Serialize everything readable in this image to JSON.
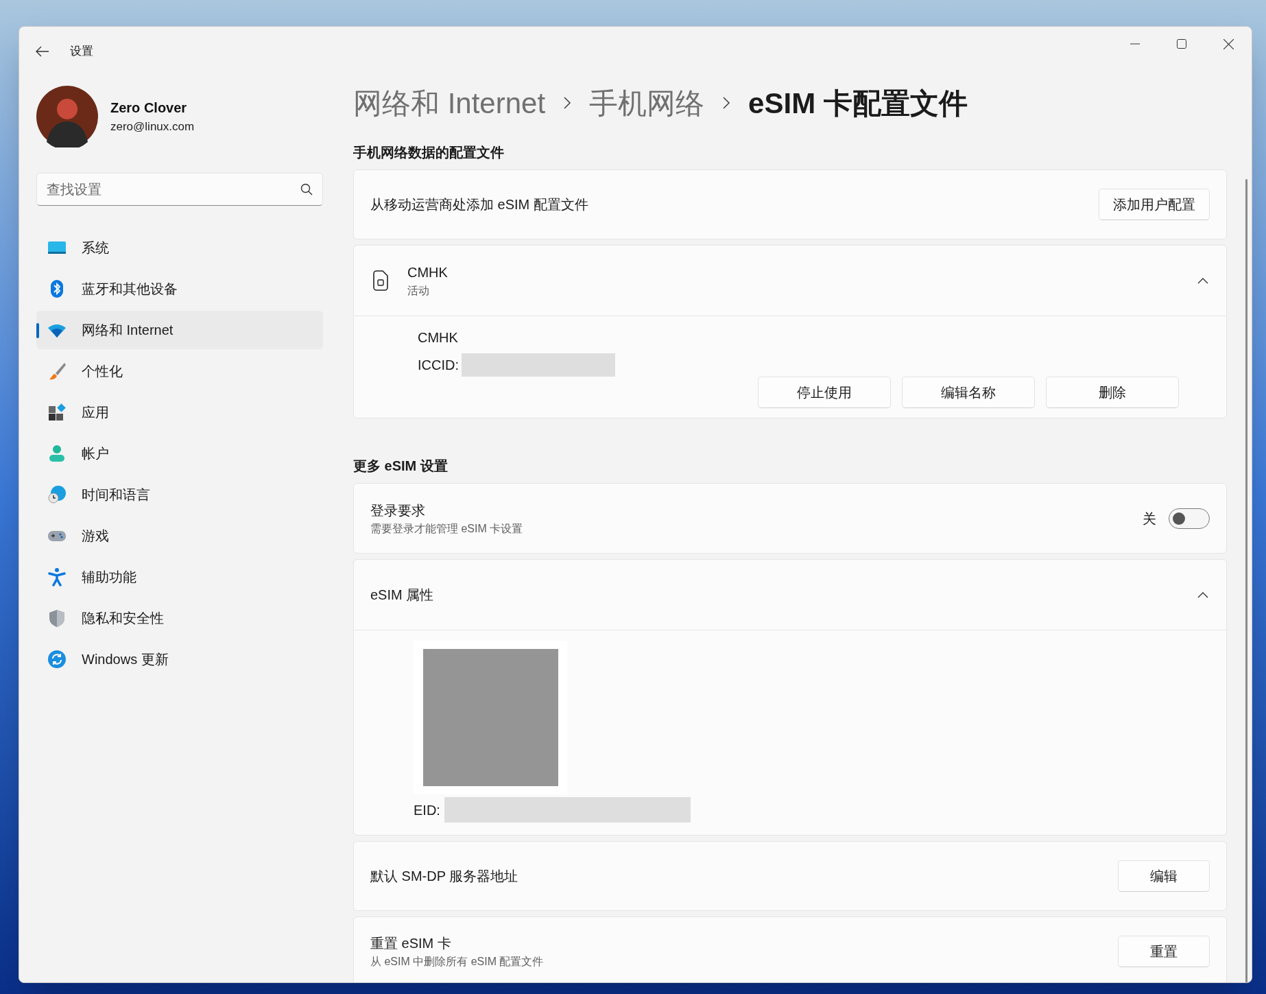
{
  "window": {
    "title": "设置"
  },
  "user": {
    "name": "Zero Clover",
    "email": "zero@linux.com"
  },
  "search": {
    "placeholder": "查找设置"
  },
  "nav": [
    {
      "kind": "system",
      "label": "系统",
      "selected": false
    },
    {
      "kind": "bluetooth",
      "label": "蓝牙和其他设备",
      "selected": false
    },
    {
      "kind": "network",
      "label": "网络和 Internet",
      "selected": true
    },
    {
      "kind": "personalization",
      "label": "个性化",
      "selected": false
    },
    {
      "kind": "apps",
      "label": "应用",
      "selected": false
    },
    {
      "kind": "accounts",
      "label": "帐户",
      "selected": false
    },
    {
      "kind": "time",
      "label": "时间和语言",
      "selected": false
    },
    {
      "kind": "gaming",
      "label": "游戏",
      "selected": false
    },
    {
      "kind": "accessibility",
      "label": "辅助功能",
      "selected": false
    },
    {
      "kind": "privacy",
      "label": "隐私和安全性",
      "selected": false
    },
    {
      "kind": "update",
      "label": "Windows 更新",
      "selected": false
    }
  ],
  "breadcrumb": [
    {
      "label": "网络和 Internet",
      "current": false
    },
    {
      "label": "手机网络",
      "current": false
    },
    {
      "label": "eSIM 卡配置文件",
      "current": true
    }
  ],
  "profiles_section": {
    "heading": "手机网络数据的配置文件",
    "add_row": {
      "label": "从移动运营商处添加 eSIM 配置文件",
      "button": "添加用户配置"
    },
    "profile": {
      "name": "CMHK",
      "status": "活动",
      "expanded": true,
      "detail_name": "CMHK",
      "iccid_label": "ICCID:",
      "buttons": [
        "停止使用",
        "编辑名称",
        "删除"
      ]
    }
  },
  "more_section": {
    "heading": "更多 eSIM 设置",
    "login": {
      "title": "登录要求",
      "subtitle": "需要登录才能管理 eSIM 卡设置",
      "toggle_label": "关",
      "on": false
    },
    "properties": {
      "title": "eSIM 属性",
      "expanded": true,
      "eid_label": "EID:"
    },
    "smdp": {
      "title": "默认 SM-DP 服务器地址",
      "button": "编辑"
    },
    "reset": {
      "title": "重置 eSIM 卡",
      "subtitle": "从 eSIM 中删除所有 eSIM 配置文件",
      "button": "重置"
    }
  }
}
